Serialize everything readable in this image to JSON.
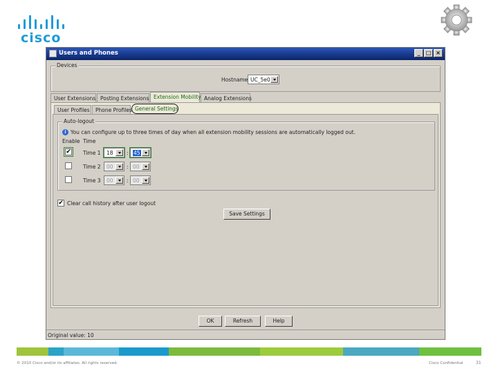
{
  "brand": {
    "logo_text": "cisco",
    "accent": "#1f9bd7"
  },
  "window": {
    "title": "Users and Phones",
    "minimize": "_",
    "maximize": "□",
    "close": "×"
  },
  "devices": {
    "legend": "Devices",
    "hostname_label": "Hostname",
    "hostname_value": "UC_5e0"
  },
  "tabs_main": [
    {
      "label": "User Extensions"
    },
    {
      "label": "Posting Extensions"
    },
    {
      "label": "Extension Mobility"
    },
    {
      "label": "Analog Extensions"
    }
  ],
  "tabs_sub": [
    {
      "label": "User Profiles"
    },
    {
      "label": "Phone Profiles"
    },
    {
      "label": "General Settings"
    }
  ],
  "autologout": {
    "legend": "Auto-logout",
    "info": "You can configure up to three times of day when all extension mobility sessions are automatically logged out.",
    "col_enable": "Enable",
    "col_time": "Time",
    "rows": [
      {
        "label": "Time 1",
        "checked": "✔",
        "hour": "18",
        "minute": "45"
      },
      {
        "label": "Time 2",
        "checked": "",
        "hour": "00",
        "minute": "00"
      },
      {
        "label": "Time 3",
        "checked": "",
        "hour": "00",
        "minute": "00"
      }
    ]
  },
  "clear_history": {
    "checked": "✔",
    "label": "Clear call history after user logout"
  },
  "save_settings": "Save Settings",
  "buttons": {
    "ok": "OK",
    "refresh": "Refresh",
    "help": "Help"
  },
  "status": "Original value: 10",
  "footer": {
    "copyright": "© 2010 Cisco and/or its affiliates. All rights reserved.",
    "confidential": "Cisco Confidential",
    "page": "31"
  },
  "footer_colors": [
    "#a0c43c",
    "#2aa3c8",
    "#5cb8d8",
    "#1b9acb",
    "#7dbb3c",
    "#9ccc3c",
    "#4aa8c0",
    "#6fc040"
  ]
}
